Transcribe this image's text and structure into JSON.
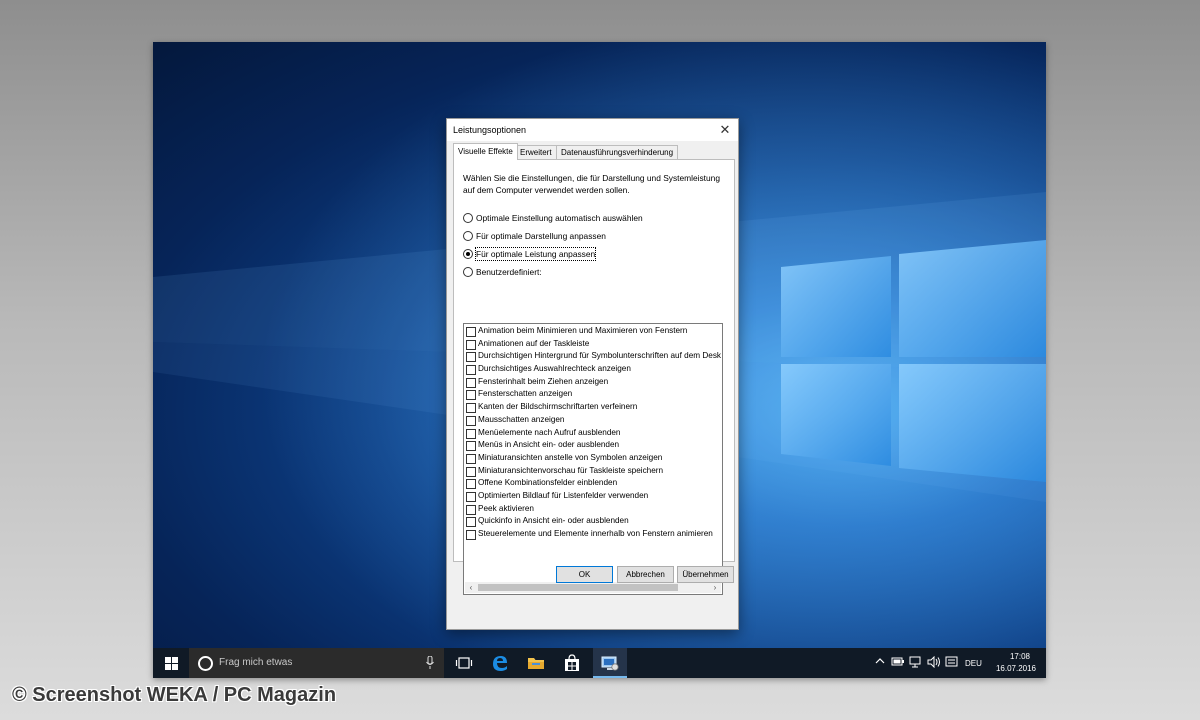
{
  "dialog": {
    "title": "Leistungsoptionen",
    "close_icon": "close-icon",
    "tabs": [
      {
        "label": "Visuelle Effekte",
        "active": true
      },
      {
        "label": "Erweitert",
        "active": false
      },
      {
        "label": "Datenausführungsverhinderung",
        "active": false
      }
    ],
    "description": "Wählen Sie die Einstellungen, die für Darstellung und Systemleistung auf dem Computer verwendet werden sollen.",
    "radios": [
      {
        "label": "Optimale Einstellung automatisch auswählen",
        "selected": false
      },
      {
        "label": "Für optimale Darstellung anpassen",
        "selected": false
      },
      {
        "label": "Für optimale Leistung anpassen",
        "selected": true
      },
      {
        "label": "Benutzerdefiniert:",
        "selected": false
      }
    ],
    "effects": [
      {
        "label": "Animation beim Minimieren und Maximieren von Fenstern",
        "checked": false
      },
      {
        "label": "Animationen auf der Taskleiste",
        "checked": false
      },
      {
        "label": "Durchsichtigen Hintergrund für Symbolunterschriften auf dem Desktop",
        "checked": false
      },
      {
        "label": "Durchsichtiges Auswahlrechteck anzeigen",
        "checked": false
      },
      {
        "label": "Fensterinhalt beim Ziehen anzeigen",
        "checked": false
      },
      {
        "label": "Fensterschatten anzeigen",
        "checked": false
      },
      {
        "label": "Kanten der Bildschirmschriftarten verfeinern",
        "checked": false
      },
      {
        "label": "Mausschatten anzeigen",
        "checked": false
      },
      {
        "label": "Menüelemente nach Aufruf ausblenden",
        "checked": false
      },
      {
        "label": "Menüs in Ansicht ein- oder ausblenden",
        "checked": false
      },
      {
        "label": "Miniaturansichten anstelle von Symbolen anzeigen",
        "checked": false
      },
      {
        "label": "Miniaturansichtenvorschau für Taskleiste speichern",
        "checked": false
      },
      {
        "label": "Offene Kombinationsfelder einblenden",
        "checked": false
      },
      {
        "label": "Optimierten Bildlauf für Listenfelder verwenden",
        "checked": false
      },
      {
        "label": "Peek aktivieren",
        "checked": false
      },
      {
        "label": "Quickinfo in Ansicht ein- oder ausblenden",
        "checked": false
      },
      {
        "label": "Steuerelemente und Elemente innerhalb von Fenstern animieren",
        "checked": false
      }
    ],
    "buttons": {
      "ok": "OK",
      "cancel": "Abbrechen",
      "apply": "Übernehmen"
    }
  },
  "taskbar": {
    "start_icon": "windows-logo-icon",
    "search_placeholder": "Frag mich etwas",
    "pinned": [
      "task-view-icon",
      "edge-icon",
      "file-explorer-icon",
      "store-icon",
      "performance-options-icon"
    ],
    "tray": {
      "icons": [
        "chevron-up-icon",
        "battery-icon",
        "network-icon",
        "volume-icon",
        "keyboard-icon"
      ],
      "language": "DEU",
      "time": "17:08",
      "date": "16.07.2016"
    }
  },
  "watermark": "© Screenshot WEKA / PC Magazin",
  "colors": {
    "accent": "#0078d7",
    "taskbar": "#101a26",
    "desktop": "#0d3f86"
  }
}
